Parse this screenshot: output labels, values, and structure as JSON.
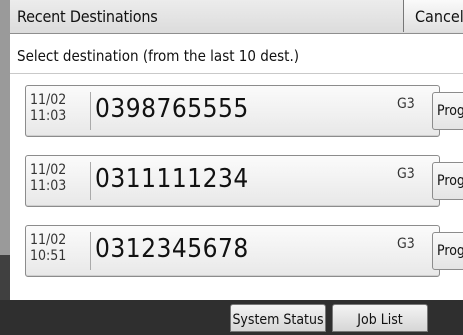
{
  "header": {
    "title": "Recent Destinations",
    "cancel_label": "Cancel"
  },
  "subtitle": "Select destination (from the last 10 dest.)",
  "destinations": [
    {
      "date": "11/02",
      "time": "11:03",
      "number": "0398765555",
      "mode": "G3",
      "prog_label": "Prog."
    },
    {
      "date": "11/02",
      "time": "11:03",
      "number": "0311111234",
      "mode": "G3",
      "prog_label": "Prog."
    },
    {
      "date": "11/02",
      "time": "10:51",
      "number": "0312345678",
      "mode": "G3",
      "prog_label": "Prog."
    }
  ],
  "footer": {
    "system_status_label": "System Status",
    "job_list_label": "Job List"
  }
}
